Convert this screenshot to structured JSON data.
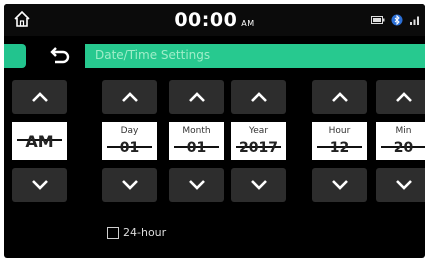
{
  "status": {
    "time": "00:00",
    "ampm": "AM",
    "icons": [
      "battery-icon",
      "bluetooth-icon",
      "signal-icon"
    ]
  },
  "header": {
    "title": "Date/Time Settings",
    "back_icon": "back-icon"
  },
  "columns": [
    {
      "id": "ampm",
      "label": "",
      "value": "AM"
    },
    {
      "id": "day",
      "label": "Day",
      "value": "01"
    },
    {
      "id": "month",
      "label": "Month",
      "value": "01"
    },
    {
      "id": "year",
      "label": "Year",
      "value": "2017"
    },
    {
      "id": "hour",
      "label": "Hour",
      "value": "12"
    },
    {
      "id": "min",
      "label": "Min",
      "value": "20"
    }
  ],
  "options": {
    "hour24_label": "24-hour",
    "hour24_checked": false
  },
  "colors": {
    "accent": "#27c98f",
    "background": "#000000",
    "button": "#2d2d2d"
  }
}
